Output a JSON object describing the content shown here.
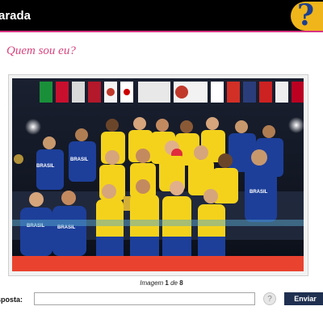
{
  "header": {
    "title": "arada",
    "help_icon": "question-mark-icon",
    "help_glyph": "?",
    "colors": {
      "bar": "#000000",
      "accent": "#d63384",
      "badge": "#f0b51a",
      "badge_glyph": "#1d3f8f"
    }
  },
  "quiz": {
    "subtitle": "Quem sou eu?",
    "photo": {
      "description": "team-photo",
      "jersey_text": "BRASIL"
    },
    "caption": {
      "prefix": "Imagem",
      "current": "1",
      "separator": "de",
      "total": "8"
    },
    "answer": {
      "label": "sposta:",
      "value": "",
      "placeholder": ""
    },
    "hint_icon": "help-circle-icon",
    "hint_glyph": "?",
    "submit_label": "Enviar",
    "colors": {
      "subtitle": "#d9447c",
      "submit_bg": "#1f2f50"
    }
  }
}
